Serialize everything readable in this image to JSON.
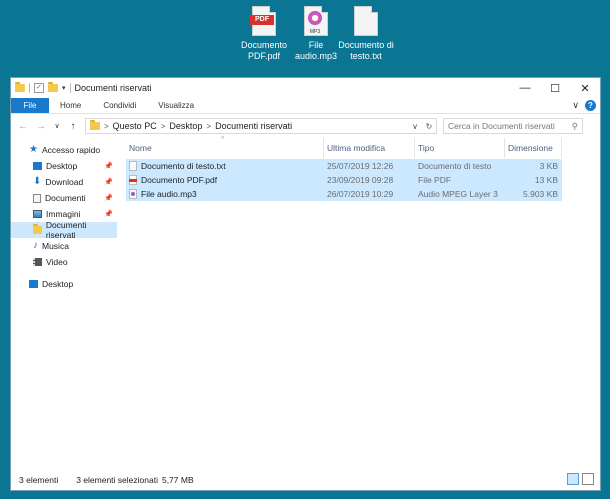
{
  "desktop_icons": [
    {
      "label": "Documento PDF.pdf",
      "icon": "pdf-file-icon",
      "badge": "PDF"
    },
    {
      "label": "File audio.mp3",
      "icon": "mp3-file-icon",
      "badge": "MP3"
    },
    {
      "label": "Documento di testo.txt",
      "icon": "text-file-icon"
    }
  ],
  "window": {
    "title": "Documenti riservati",
    "controls": {
      "minimize": "—",
      "maximize": "☐",
      "close": "✕"
    }
  },
  "ribbon": {
    "tabs": [
      "File",
      "Home",
      "Condividi",
      "Visualizza"
    ],
    "help": "?",
    "expand": "∨"
  },
  "address": {
    "back": "←",
    "forward": "→",
    "recent": "∨",
    "up": "↑",
    "crumbs": [
      "Questo PC",
      "Desktop",
      "Documenti riservati"
    ],
    "separator": ">",
    "dropdown": "∨",
    "refresh": "↻",
    "search_placeholder": "Cerca in Documenti riservati",
    "search_icon": "⚲"
  },
  "sidebar": {
    "quick_access": "Accesso rapido",
    "items": [
      {
        "label": "Desktop",
        "pinned": "📌"
      },
      {
        "label": "Download",
        "pinned": "📌"
      },
      {
        "label": "Documenti",
        "pinned": "📌"
      },
      {
        "label": "Immagini",
        "pinned": "📌"
      },
      {
        "label": "Documenti riservati"
      },
      {
        "label": "Musica"
      },
      {
        "label": "Video"
      }
    ],
    "desktop_root": "Desktop"
  },
  "columns": {
    "name": "Nome",
    "modified": "Ultima modifica",
    "type": "Tipo",
    "size": "Dimensione",
    "sort": "^"
  },
  "files": [
    {
      "name": "Documento di testo.txt",
      "modified": "25/07/2019 12:26",
      "type": "Documento di testo",
      "size": "3 KB",
      "icon": "txt"
    },
    {
      "name": "Documento PDF.pdf",
      "modified": "23/09/2019 09:28",
      "type": "File PDF",
      "size": "13 KB",
      "icon": "pdf"
    },
    {
      "name": "File audio.mp3",
      "modified": "26/07/2019 10:29",
      "type": "Audio MPEG Layer 3",
      "size": "5.903 KB",
      "icon": "mp3"
    }
  ],
  "status": {
    "count": "3 elementi",
    "selection": "3 elementi selezionati",
    "size": "5,77 MB"
  },
  "colors": {
    "desktop": "#0a7694",
    "accent": "#1979ca",
    "selection": "#cce8ff"
  }
}
